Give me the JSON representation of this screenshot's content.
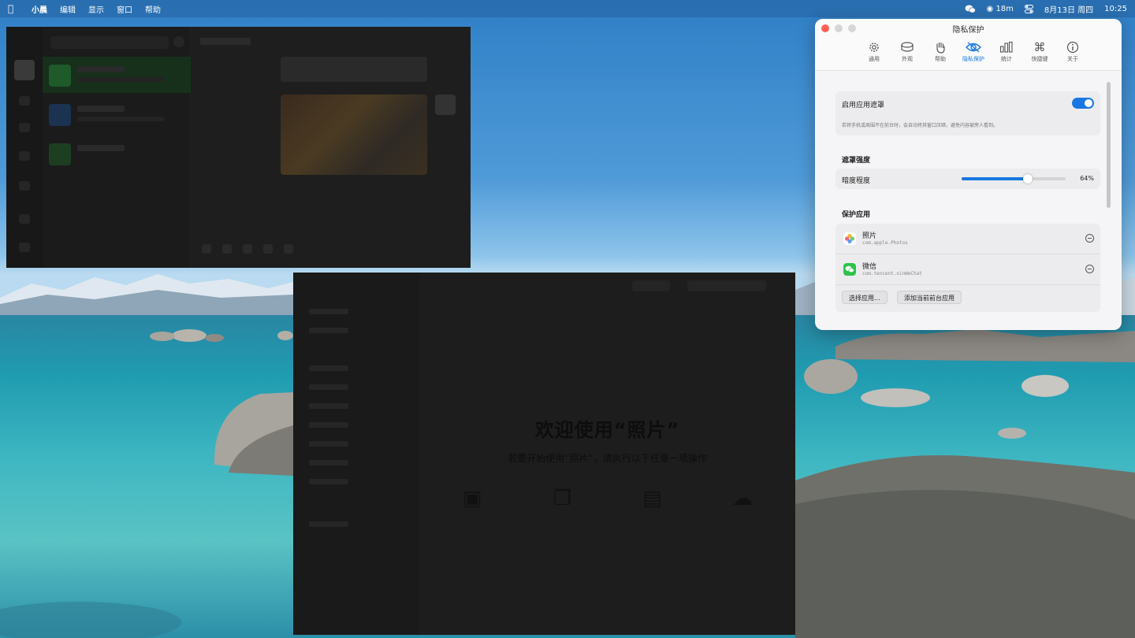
{
  "menubar": {
    "apple_icon": "apple-icon",
    "items": [
      "小晨",
      "编辑",
      "显示",
      "窗口",
      "帮助"
    ],
    "status": {
      "timer": "18m",
      "date": "8月13日 周四",
      "time": "10:25"
    }
  },
  "photos_window": {
    "welcome_title": "欢迎使用“照片”",
    "welcome_subtitle": "若要开始使用“照片”，请执行以下任意一项操作"
  },
  "settings": {
    "title": "隐私保护",
    "tabs": [
      {
        "label": "通用",
        "icon": "gear-icon"
      },
      {
        "label": "外观",
        "icon": "appearance-icon"
      },
      {
        "label": "帮助",
        "icon": "hand-icon"
      },
      {
        "label": "隐私保护",
        "icon": "eye-icon",
        "active": true
      },
      {
        "label": "统计",
        "icon": "chart-icon"
      },
      {
        "label": "快捷键",
        "icon": "command-icon"
      },
      {
        "label": "关于",
        "icon": "info-icon"
      }
    ],
    "enable_masking": {
      "label": "启用应用遮罩",
      "on": true,
      "description": "若将手机或周围不在前台时，会自动将其窗口压暗，避免内容被旁人看到。"
    },
    "mask_strength": {
      "section": "遮罩强度",
      "label": "暗度程度",
      "value_text": "64%",
      "value": 0.64
    },
    "protected_apps": {
      "section": "保护应用",
      "apps": [
        {
          "name": "照片",
          "bundle": "com.apple.Photos",
          "icon": "photos-app-icon"
        },
        {
          "name": "微信",
          "bundle": "com.tencent.xinWeChat",
          "icon": "wechat-app-icon"
        }
      ],
      "choose_button": "选择应用...",
      "add_front_button": "添加当前前台应用"
    },
    "colors": {
      "accent": "#1877e0",
      "close": "#ff5f57"
    }
  }
}
